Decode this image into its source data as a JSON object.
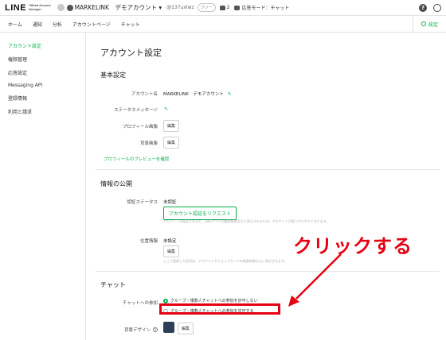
{
  "topbar": {
    "logo_main": "LINE",
    "logo_sub_1": "Official Account",
    "logo_sub_2": "Manager",
    "account_name": "MARKELINK　デモアカウント",
    "account_dropdown": "▾",
    "account_id": "@137uxlwz",
    "follow_badge": "フリー",
    "friends_count": "2",
    "chat_mode": "応答モード：チャット",
    "help_icon_glyph": "?"
  },
  "nav": {
    "items": [
      "ホーム",
      "通知",
      "分析",
      "アカウントページ",
      "チャット"
    ],
    "settings": "設定"
  },
  "sidebar": {
    "items": [
      "アカウント設定",
      "権限管理",
      "応答設定",
      "Messaging API",
      "登録情報",
      "利用と請求"
    ]
  },
  "main": {
    "title": "アカウント設定",
    "basic": {
      "title": "基本設定",
      "account_name_label": "アカウント名",
      "account_name_value": "MARKELINK　デモアカウント",
      "status_label": "ステータスメッセージ",
      "profile_image_label": "プロフィール画像",
      "profile_image_button": "編集",
      "bg_image_label": "背景画像",
      "bg_image_button": "編集",
      "preview_link": "プロフィールのプレビューを確認"
    },
    "public_info": {
      "title": "情報の公開",
      "cert_label": "認証ステータス",
      "cert_value": "未認証",
      "cert_button": "アカウント認証をリクエスト",
      "cert_help": "アカウントが認証されると、LINEアプリ内検索結果などに表示されるため、アカウントが見つかりやすくなります。",
      "location_label": "位置情報",
      "location_value": "未設定",
      "location_button": "編集",
      "location_help": "ここで登録した住所は、アカウントやショップカードの検索結果などに表示されます。"
    },
    "chat": {
      "title": "チャット",
      "join_label": "チャットへの参加",
      "option_deny": "グループ・複数人チャットへの参加を許可しない",
      "option_allow": "グループ・複数人チャットへの参加を許可する",
      "bg_design_label": "背景デザイン",
      "bg_design_help": "?",
      "bg_design_button": "編集"
    }
  },
  "annotation": {
    "text": "クリックする",
    "color": "#e60012"
  },
  "colors": {
    "accent": "#06b14b",
    "annotation_red": "#e60012",
    "chat_bg_swatch": "#2d3e56"
  }
}
